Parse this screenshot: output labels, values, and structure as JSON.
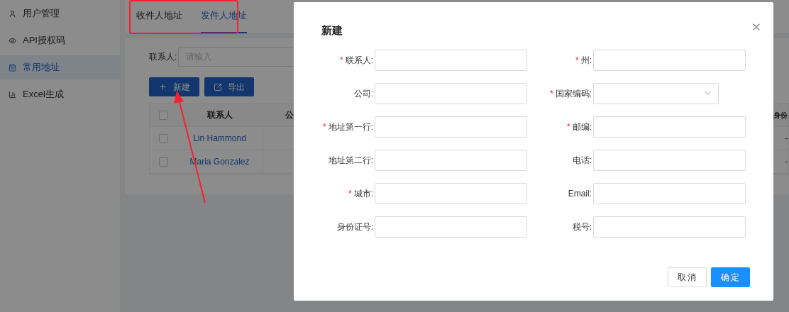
{
  "sidebar": {
    "items": [
      {
        "label": "用户管理",
        "kind": "user",
        "selected": false
      },
      {
        "label": "API授权码",
        "kind": "eye",
        "selected": false
      },
      {
        "label": "常用地址",
        "kind": "calendar",
        "selected": true
      },
      {
        "label": "Excel生成",
        "kind": "chart",
        "selected": false
      }
    ]
  },
  "tabs": [
    {
      "label": "收件人地址",
      "selected": false
    },
    {
      "label": "发件人地址",
      "selected": true
    }
  ],
  "filter": {
    "label": "联系人:",
    "placeholder": "请输入"
  },
  "toolbar": [
    {
      "label": "新建",
      "kind": "add"
    },
    {
      "label": "导出",
      "kind": "export"
    }
  ],
  "table": {
    "columns": [
      "联系人",
      "公",
      "身份"
    ],
    "select_all": {
      "checked": false
    },
    "rows": [
      {
        "checked": false,
        "contact": "Lin Hammond",
        "id_number": "-"
      },
      {
        "checked": false,
        "contact": "Maria Gonzalez",
        "id_number": "-"
      }
    ]
  },
  "dialog": {
    "title": "新建",
    "required_mark": "*",
    "fields": [
      {
        "label": "联系人:",
        "required": true,
        "kind": "text"
      },
      {
        "label": "州:",
        "required": true,
        "kind": "text"
      },
      {
        "label": "公司:",
        "required": false,
        "kind": "text"
      },
      {
        "label": "国家编码:",
        "required": true,
        "kind": "select"
      },
      {
        "label": "地址第一行:",
        "required": true,
        "kind": "text"
      },
      {
        "label": "邮编:",
        "required": true,
        "kind": "text"
      },
      {
        "label": "地址第二行:",
        "required": false,
        "kind": "text"
      },
      {
        "label": "电话:",
        "required": false,
        "kind": "text"
      },
      {
        "label": "城市:",
        "required": true,
        "kind": "text"
      },
      {
        "label": "Email:",
        "required": false,
        "kind": "text"
      },
      {
        "label": "身份证号:",
        "required": false,
        "kind": "text"
      },
      {
        "label": "税号:",
        "required": false,
        "kind": "text"
      }
    ],
    "buttons": [
      {
        "label": "取消",
        "kind": "default"
      },
      {
        "label": "确定",
        "kind": "primary"
      }
    ]
  },
  "highlight_box": {
    "color": "#f5222d"
  },
  "arrow": {
    "color": "#f5222d"
  }
}
